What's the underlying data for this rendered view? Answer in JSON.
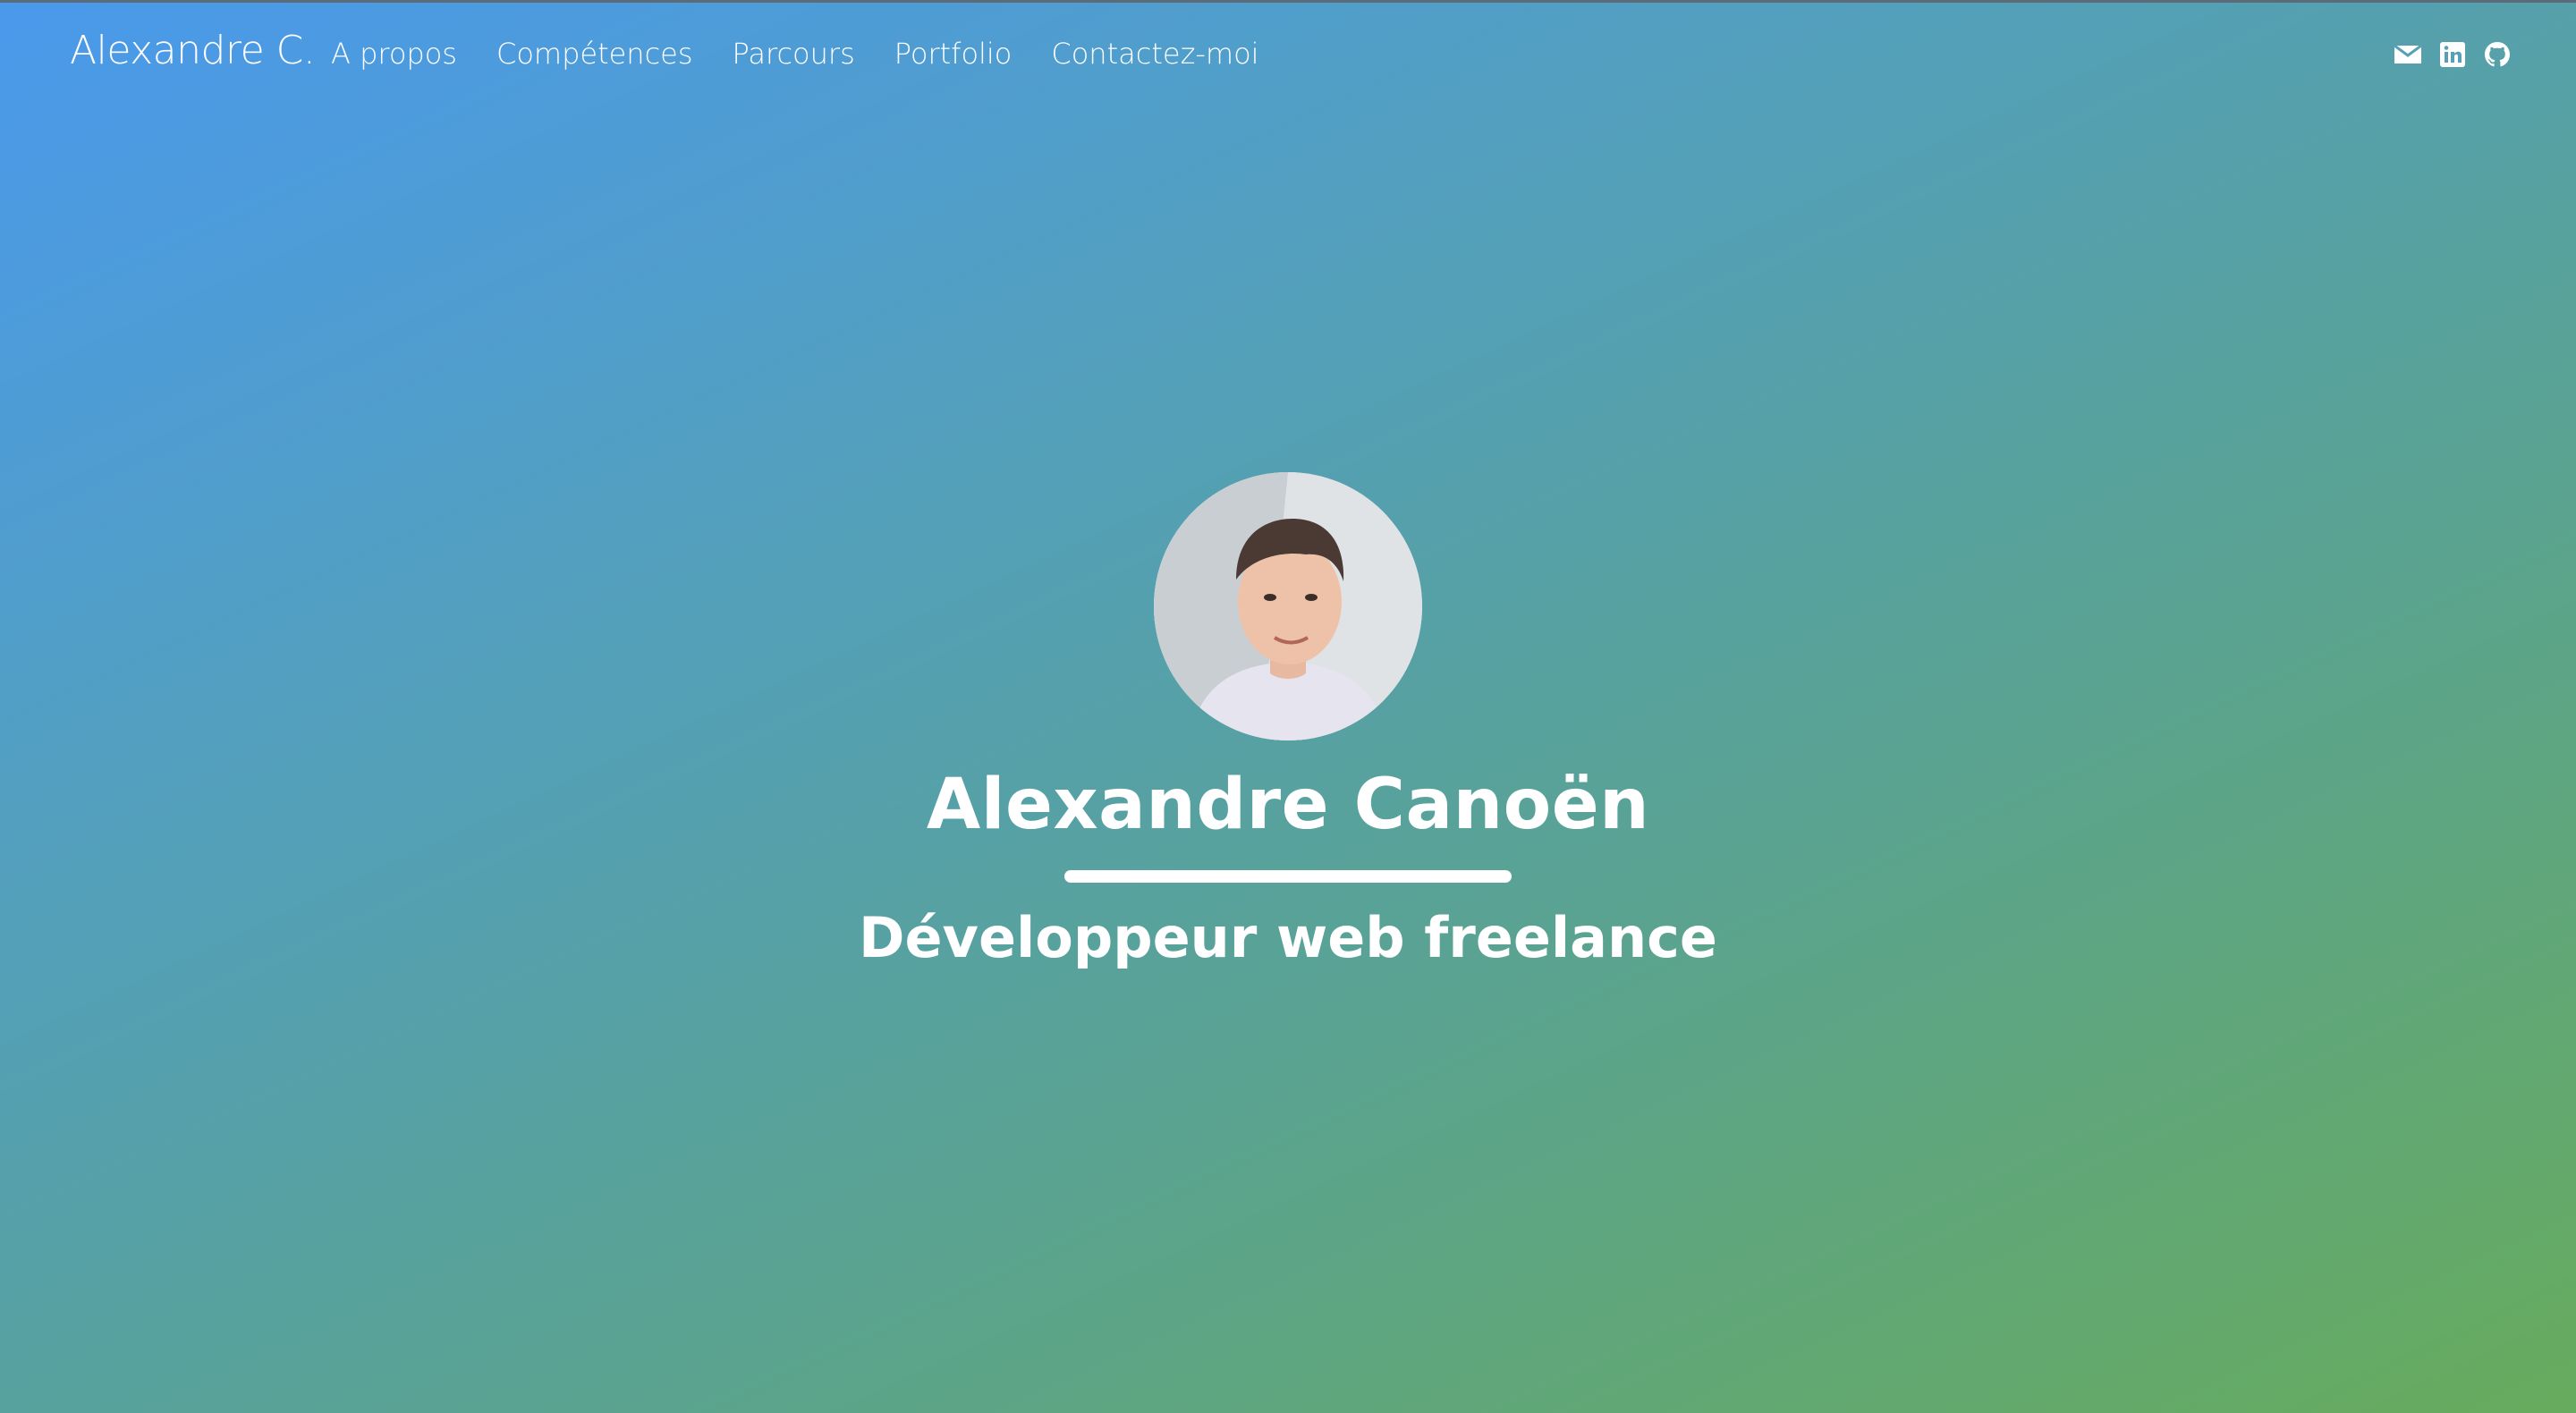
{
  "navbar": {
    "brand": "Alexandre C.",
    "links": [
      {
        "label": "A propos"
      },
      {
        "label": "Compétences"
      },
      {
        "label": "Parcours"
      },
      {
        "label": "Portfolio"
      },
      {
        "label": "Contactez-moi"
      }
    ],
    "social_icons": [
      "envelope-icon",
      "linkedin-icon",
      "github-icon"
    ]
  },
  "hero": {
    "name": "Alexandre Canoën",
    "subtitle": "Développeur web freelance"
  },
  "colors": {
    "gradient_start": "#4a99ec",
    "gradient_end": "#67ab5d",
    "text": "#ffffff"
  }
}
